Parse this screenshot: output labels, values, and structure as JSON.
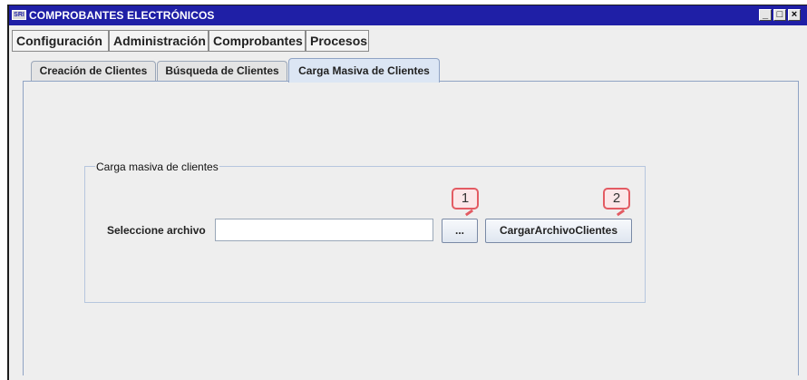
{
  "window": {
    "app_icon": "SRI",
    "title": "COMPROBANTES ELECTRÓNICOS",
    "controls": {
      "minimize": "_",
      "maximize": "□",
      "close": "×"
    }
  },
  "menu": {
    "items": [
      "Configuración",
      "Administración",
      "Comprobantes",
      "Procesos"
    ]
  },
  "tabs": {
    "items": [
      "Creación de Clientes",
      "Búsqueda de Clientes",
      "Carga Masiva de Clientes"
    ],
    "active": "Carga Masiva de Clientes"
  },
  "form": {
    "legend": "Carga masiva de clientes",
    "file_label": "Seleccione archivo",
    "file_value": "",
    "browse_label": "...",
    "upload_label": "CargarArchivoClientes"
  },
  "callouts": [
    "1",
    "2"
  ],
  "colors": {
    "titlebar": "#1f1fa6",
    "callout_border": "#e35b63",
    "callout_fill": "#fbe7e9",
    "active_tab": "#dce6f4"
  }
}
